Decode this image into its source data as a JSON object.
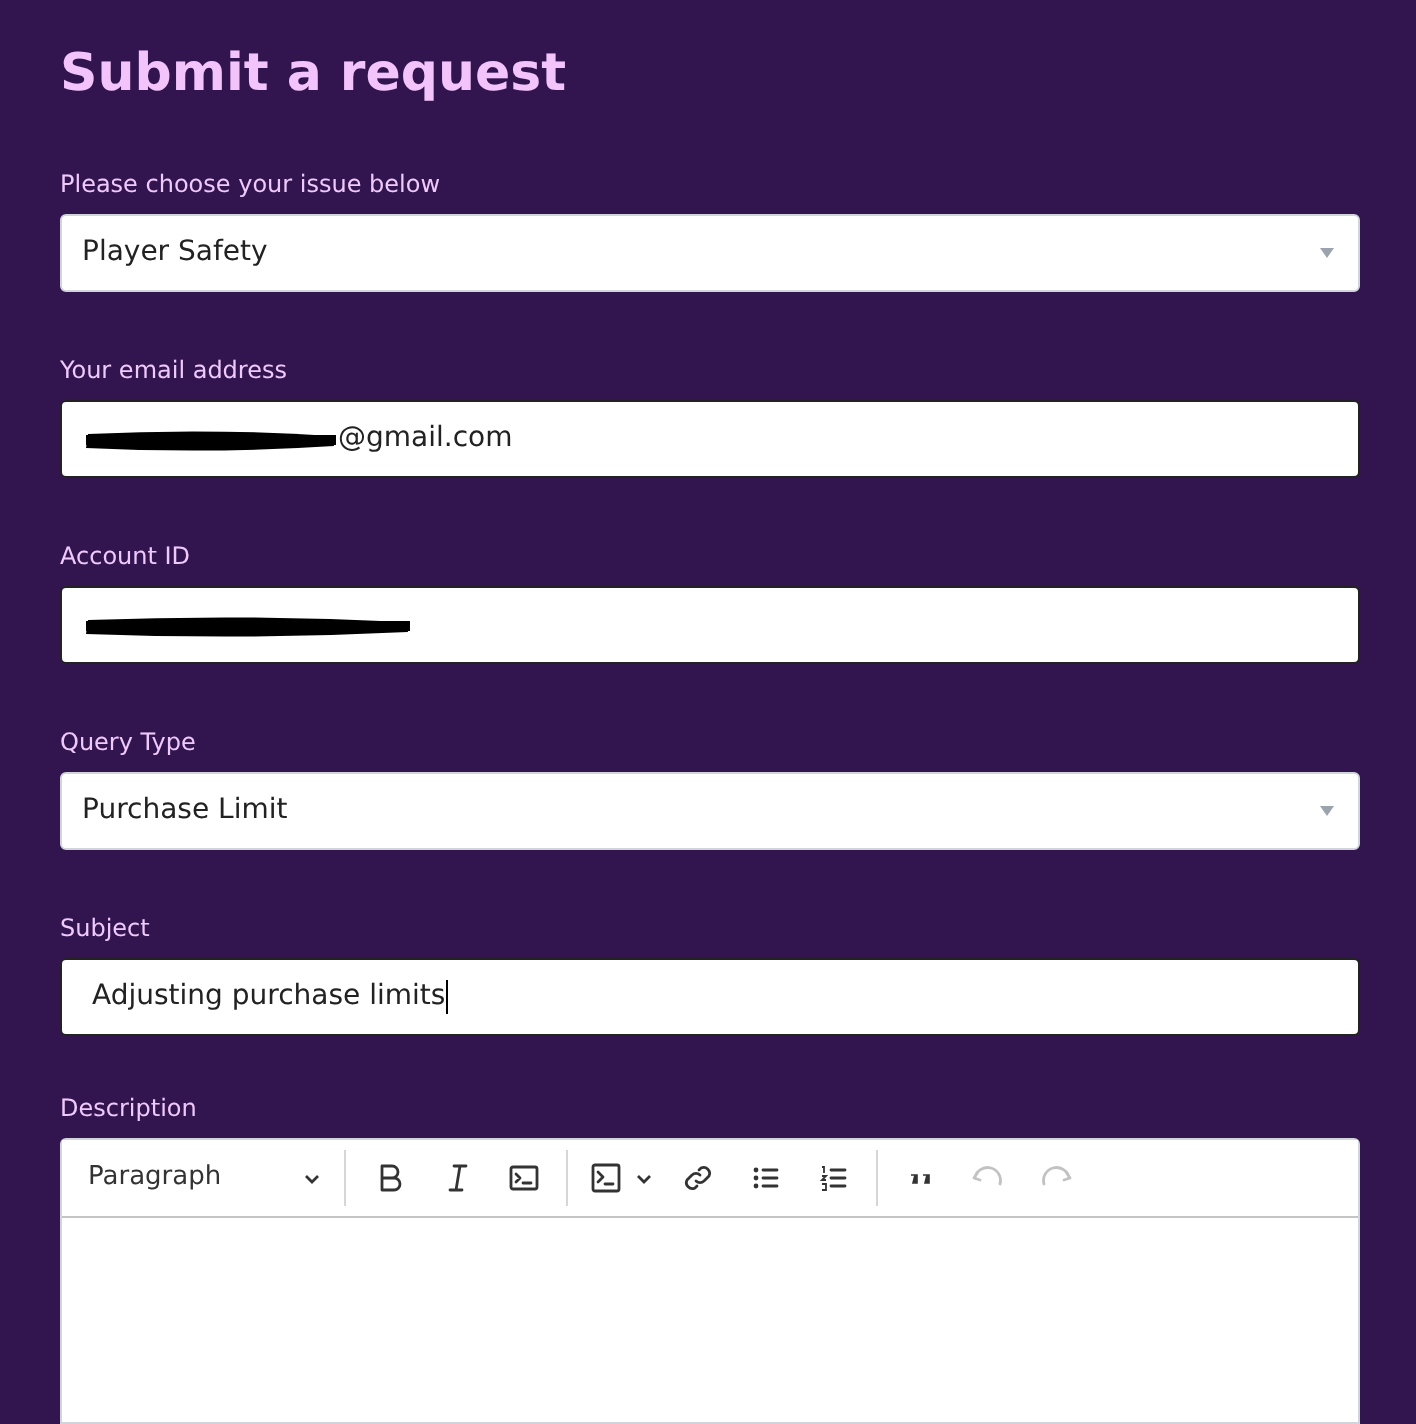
{
  "title": "Submit a request",
  "fields": [
    {
      "kind": "select",
      "label": "Please choose your issue below",
      "value": "Player Safety"
    },
    {
      "kind": "text",
      "label": "Your email address",
      "value": "@gmail.com",
      "redacted": true
    },
    {
      "kind": "text",
      "label": "Account ID",
      "redacted": true
    },
    {
      "kind": "select",
      "label": "Query Type",
      "value": "Purchase Limit"
    },
    {
      "kind": "text",
      "label": "Subject",
      "value": "Adjusting purchase limits",
      "redacted": false,
      "focused": true
    }
  ],
  "description": {
    "label": "Description",
    "toolbar": [
      {
        "kind": "block-format",
        "label": "Paragraph",
        "disabled": false
      },
      {
        "kind": "separator"
      },
      {
        "kind": "bold",
        "disabled": false
      },
      {
        "kind": "italic",
        "disabled": false
      },
      {
        "kind": "code",
        "disabled": false
      },
      {
        "kind": "separator"
      },
      {
        "kind": "code-block",
        "disabled": false
      },
      {
        "kind": "link",
        "disabled": false
      },
      {
        "kind": "bulleted-list",
        "disabled": false
      },
      {
        "kind": "numbered-list",
        "disabled": false
      },
      {
        "kind": "separator"
      },
      {
        "kind": "quote",
        "disabled": false
      },
      {
        "kind": "undo",
        "disabled": true
      },
      {
        "kind": "redo",
        "disabled": true
      }
    ]
  }
}
